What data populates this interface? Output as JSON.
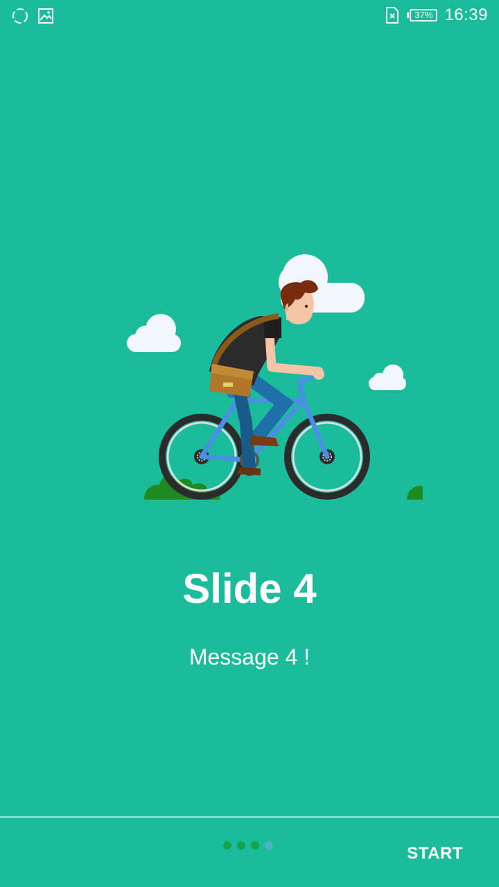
{
  "status_bar": {
    "time": "16:39",
    "battery_percent": "37%",
    "icons": [
      "sync-icon",
      "image-icon",
      "no-sim-icon",
      "battery-icon"
    ]
  },
  "slide": {
    "title": "Slide 4",
    "message": "Message 4 !",
    "illustration": "cyclist-illustration"
  },
  "footer": {
    "start_label": "START",
    "page_count": 4,
    "active_page": 4
  },
  "colors": {
    "background": "#1bbc9b",
    "dot_inactive": "#15a24a",
    "dot_active": "#4fb1c4"
  }
}
